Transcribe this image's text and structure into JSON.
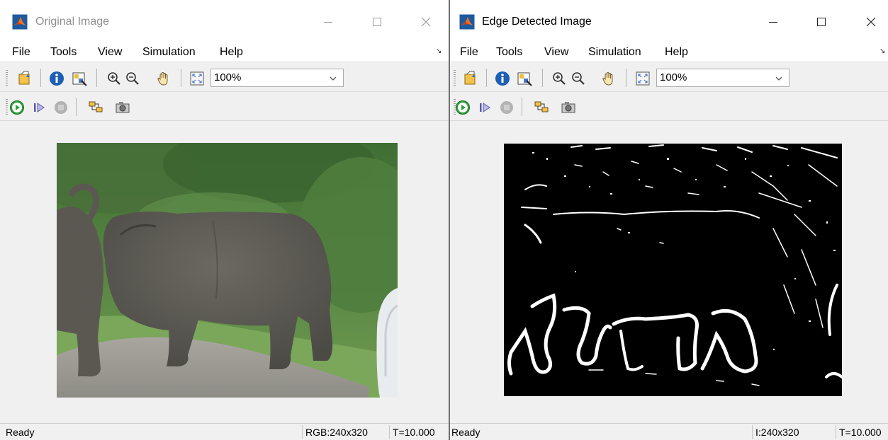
{
  "left_window": {
    "title": "Original Image",
    "menu": [
      "File",
      "Tools",
      "View",
      "Simulation",
      "Help"
    ],
    "zoom": "100%",
    "status": {
      "ready": "Ready",
      "dims": "RGB:240x320",
      "time": "T=10.000"
    }
  },
  "right_window": {
    "title": "Edge Detected Image",
    "menu": [
      "File",
      "Tools",
      "View",
      "Simulation",
      "Help"
    ],
    "zoom": "100%",
    "status": {
      "ready": "Ready",
      "dims": "I:240x320",
      "time": "T=10.000"
    }
  },
  "colors": {
    "window_bg": "#f0f0f0",
    "titlebar_bg": "#ffffff",
    "edge_bg": "#000000",
    "edge_fg": "#ffffff",
    "play_green": "#2e9e3a",
    "vegetation": "#4e7a3a",
    "rhino_gray": "#5c5a54",
    "road": "#a4a29c"
  }
}
